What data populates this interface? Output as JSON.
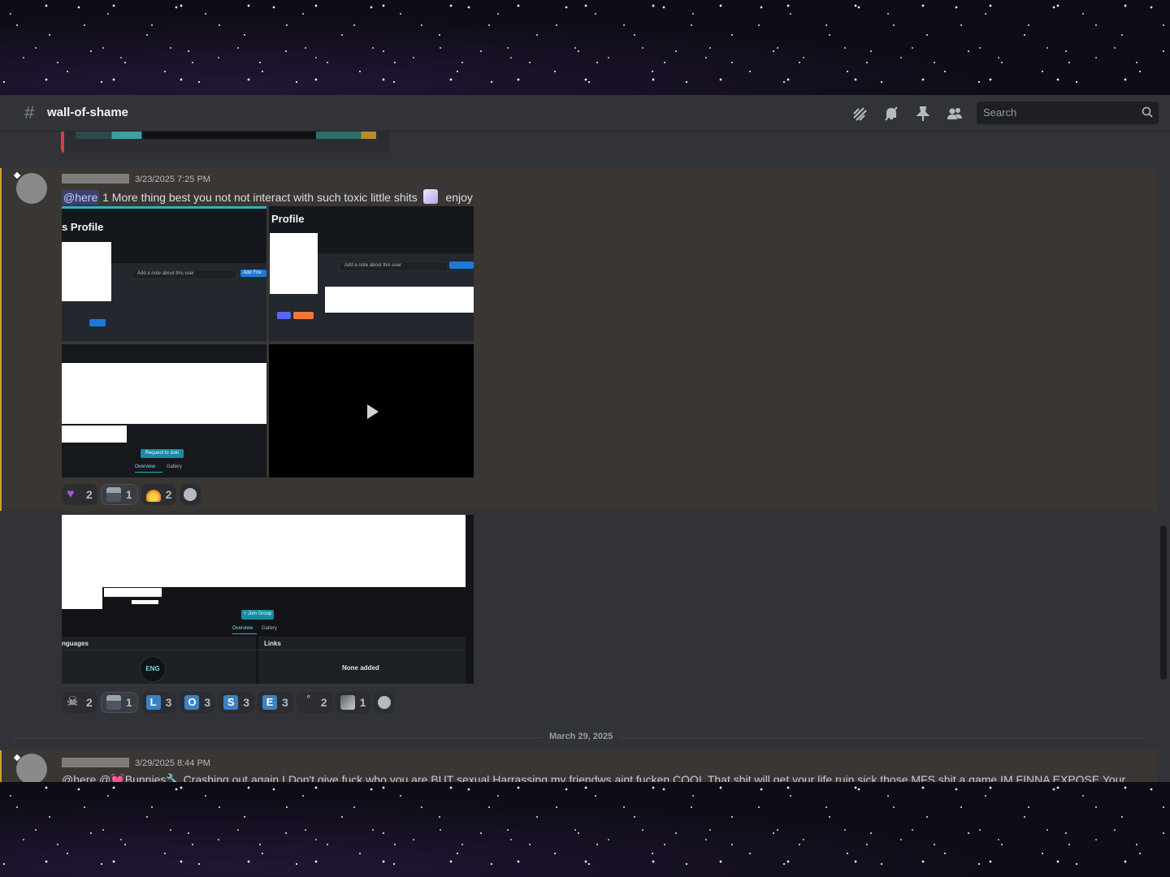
{
  "channel": {
    "name": "wall-of-shame"
  },
  "header": {
    "icons": [
      "threads-icon",
      "mute-bell-icon",
      "pin-icon",
      "member-list-icon"
    ],
    "search_placeholder": "Search"
  },
  "messages": [
    {
      "timestamp": "3/23/2025 7:25 PM",
      "mention": "@here",
      "text": "1 More thing best you not not interact with such toxic little shits",
      "trailing": "enjoy",
      "media": {
        "panel1_title": "s Profile",
        "panel2_title": "Profile",
        "note_placeholder": "Add a note about this user",
        "add_friend": "Add Frie",
        "request_to_join": "Request to Join",
        "tab_overview": "Overview",
        "tab_gallery": "Gallery"
      },
      "reactions": [
        {
          "icon": "purple-heart-icon",
          "count": "2"
        },
        {
          "icon": "custom-emoji-icon",
          "count": "1",
          "active": true
        },
        {
          "icon": "fire-icon",
          "count": "2"
        }
      ]
    },
    {
      "media": {
        "join_group": "+ Join Group",
        "tab_overview": "Overview",
        "tab_gallery": "Gallery",
        "languages_header": "nguages",
        "links_header": "Links",
        "lang_badge": "ENG",
        "links_value": "None added"
      },
      "reactions": [
        {
          "icon": "skull-icon",
          "count": "2"
        },
        {
          "icon": "custom-emoji-icon",
          "count": "1",
          "active": true
        },
        {
          "icon": "letter-l-icon",
          "letter": "L",
          "count": "3"
        },
        {
          "icon": "letter-o-icon",
          "letter": "O",
          "count": "3"
        },
        {
          "icon": "letter-s-icon",
          "letter": "S",
          "count": "3"
        },
        {
          "icon": "letter-e-icon",
          "letter": "E",
          "count": "3"
        },
        {
          "icon": "degree-icon",
          "count": "2"
        },
        {
          "icon": "custom-emoji-2-icon",
          "count": "1"
        }
      ]
    }
  ],
  "date_divider": "March 29, 2025",
  "last_message": {
    "timestamp": "3/29/2025 8:44 PM",
    "text": "@here @💓Bunnies🔧  Crashing out again I Don't give fuck who you are BUT sexual Harrassing my friendws aint fucken COOL That shit will get your life ruin sick those MFS shit a game IM FINNA EXPOSE Your"
  }
}
